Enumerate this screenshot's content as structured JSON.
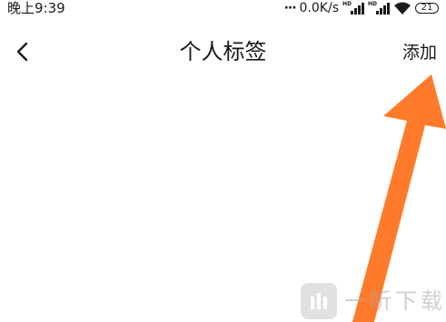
{
  "status_bar": {
    "time": "晚上9:39",
    "network_speed": "0.0K/s",
    "signal_label": "HD",
    "battery_level": "21"
  },
  "nav": {
    "title": "个人标签",
    "add_label": "添加"
  },
  "watermark": {
    "text": "一听下载"
  },
  "colors": {
    "arrow": "#ff7a2a",
    "text": "#1a1a1a"
  }
}
